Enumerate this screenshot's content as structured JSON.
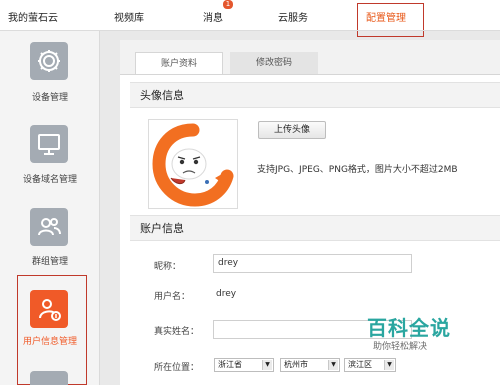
{
  "topnav": {
    "items": [
      "我的萤石云",
      "视频库",
      "消息",
      "云服务",
      "配置管理"
    ],
    "badge": "1",
    "accent": "#e85a1b"
  },
  "sidebar": {
    "items": [
      {
        "label": "设备管理",
        "icon": "gear-icon"
      },
      {
        "label": "设备域名管理",
        "icon": "monitor-icon"
      },
      {
        "label": "群组管理",
        "icon": "group-icon"
      },
      {
        "label": "用户信息管理",
        "icon": "user-info-icon"
      }
    ],
    "active_color": "#f05a28"
  },
  "tabs": [
    "账户资料",
    "修改密码"
  ],
  "avatar_section": {
    "title": "头像信息",
    "upload_label": "上传头像",
    "hint": "支持JPG、JPEG、PNG格式，图片大小不超过2MB"
  },
  "account_section": {
    "title": "账户信息",
    "nickname_label": "昵称：",
    "nickname_value": "drey",
    "username_label": "用户名：",
    "username_value": "drey",
    "realname_label": "真实姓名：",
    "realname_value": "",
    "location_label": "所在位置：",
    "province": "浙江省",
    "city": "杭州市",
    "district": "滨江区"
  },
  "watermark": {
    "title": "百科全说",
    "subtitle": "助你轻松解决"
  }
}
